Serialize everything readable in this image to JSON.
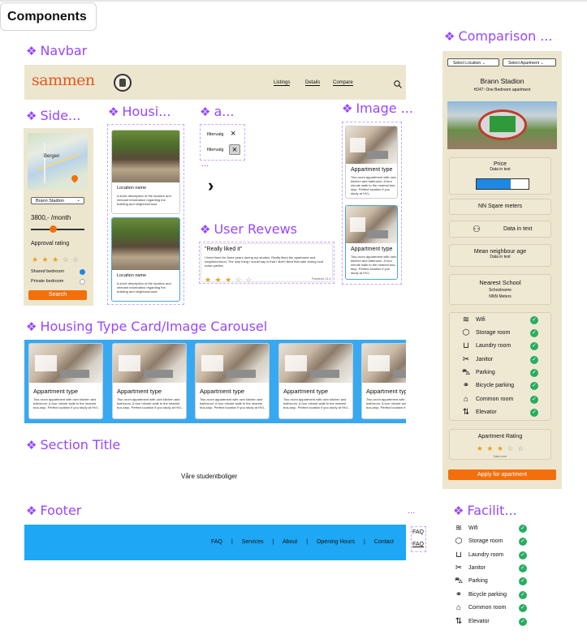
{
  "header": {
    "title": "Components"
  },
  "sections": {
    "navbar": "Navbar",
    "sidebar": "Side...",
    "housing": "Housi...",
    "a": "a...",
    "image": "Image ...",
    "reviews": "User Revews",
    "carousel": "Housing Type Card/Image Carousel",
    "section_title": "Section Title",
    "footer": "Footer",
    "facilities": "Facilit...",
    "comparison": "Comparison ...",
    "diamond": "❖"
  },
  "navbar": {
    "logo": "sammen",
    "links": [
      "Listings",
      "Details",
      "Compare"
    ]
  },
  "sidebar": {
    "map_labels": [
      "Bergen",
      "Bergen"
    ],
    "select": "Brann Stadion",
    "price": "3800,- /month",
    "rating_label": "Approval rating",
    "rating": 3,
    "options": [
      "Shared bedroom",
      "Private bedroom"
    ],
    "search": "Search"
  },
  "housing_cards": [
    {
      "title": "Location name",
      "desc": "A short description of the location and relevant information regarding the building and neighbourhood"
    },
    {
      "title": "Location name",
      "desc": "A short description of the location and relevant information regarding the building and neighbourhood"
    }
  ],
  "filters": {
    "chips": [
      "filtervalg",
      "filtervalg"
    ],
    "ellipsis": "...",
    "arrow": "›"
  },
  "apt_card": {
    "type": "Appartment type",
    "desc": "Two-room appartment with own kitchen and bathroom. A four minute walk to the nearest bus-stop. Perfect location if you study at HVL."
  },
  "carousel_desc": "Two-room appartment with own kitchen and bathroom. A four minute walk to the nearest bus-stop. Perfect location if you study at HVL.",
  "review": {
    "title": "\"Really liked it\"",
    "text": "I lived there for three years during my studies. Really liked the apartment and neighbourhood. The only thing I would say is that I didn't liked that sale during loud noise parties.",
    "date": "Published 13.4",
    "rating": 3
  },
  "section_title_text": "Våre studentboliger",
  "footer": {
    "links": [
      "FAQ",
      "Services",
      "About",
      "Opening Hours",
      "Contact"
    ],
    "separator": "|",
    "ellipsis": "...",
    "faq_items": [
      "FAQ",
      "FAQ"
    ]
  },
  "facilities": [
    {
      "icon": "wifi-icon",
      "glyph": "≋",
      "label": "Wifi"
    },
    {
      "icon": "box-icon",
      "glyph": "⬡",
      "label": "Storage room"
    },
    {
      "icon": "laundry-icon",
      "glyph": "⊔",
      "label": "Laundry room"
    },
    {
      "icon": "tools-icon",
      "glyph": "✂",
      "label": "Janitor"
    },
    {
      "icon": "car-icon",
      "glyph": "⛍",
      "label": "Parking"
    },
    {
      "icon": "bicycle-icon",
      "glyph": "⚭",
      "label": "Bicycle parking"
    },
    {
      "icon": "room-icon",
      "glyph": "⌂",
      "label": "Common room"
    },
    {
      "icon": "elevator-icon",
      "glyph": "⇅",
      "label": "Elevator"
    }
  ],
  "comparison": {
    "selects": [
      "Select Location",
      "Select Apartment"
    ],
    "title": "Brann Stadion",
    "subtitle": "H247: One Bedroom apartment",
    "price_label": "Price",
    "price_sub": "Data in text",
    "price_fill": 0.65,
    "size_label": "NN Sqare meters",
    "neighbours": "Data in text",
    "age_label": "Mean neighbour age",
    "age_sub": "Data in text",
    "school_label": "Nearest School",
    "school_name": "Schoolname",
    "school_dist": "NNN Meters",
    "rating_label": "Apartment Rating",
    "rating": 3,
    "rating_sub": "Data more",
    "apply": "Apply for apartment"
  },
  "colors": {
    "accent": "#9747ff",
    "orange": "#f36f0b",
    "blue": "#36a9f2",
    "beige": "#ece6cf"
  }
}
